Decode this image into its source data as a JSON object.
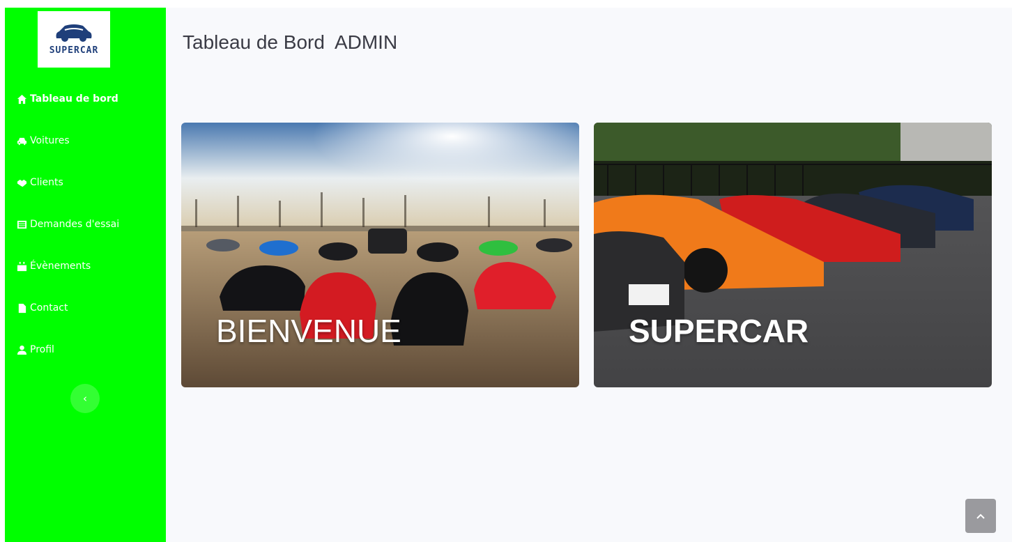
{
  "brand": {
    "logo_text": "SUPERCAR",
    "sidebar_color": "#00ff00"
  },
  "sidebar": {
    "items": [
      {
        "label": "Tableau de bord",
        "icon": "home-icon",
        "active": true
      },
      {
        "label": "Voitures",
        "icon": "car-icon"
      },
      {
        "label": "Clients",
        "icon": "handshake-icon"
      },
      {
        "label": "Demandes d'essai",
        "icon": "list-icon"
      },
      {
        "label": "Évènements",
        "icon": "calendar-icon"
      },
      {
        "label": "Contact",
        "icon": "file-icon"
      },
      {
        "label": "Profil",
        "icon": "user-icon"
      }
    ],
    "toggle_icon": "chevron-left-icon"
  },
  "main": {
    "title": "Tableau de Bord  ADMIN",
    "cards": [
      {
        "title": "BIENVENUE"
      },
      {
        "title": "SUPERCAR"
      }
    ]
  },
  "scroll_top_icon": "chevron-up-icon"
}
